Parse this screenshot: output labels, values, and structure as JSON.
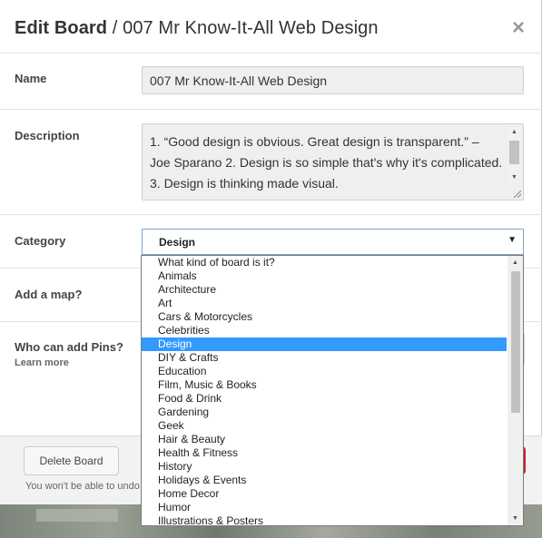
{
  "header": {
    "title_strong": "Edit Board",
    "title_separator": " / ",
    "title_board": "007 Mr Know-It-All Web Design",
    "close_glyph": "×"
  },
  "form": {
    "name_label": "Name",
    "name_value": "007 Mr Know-It-All Web Design",
    "description_label": "Description",
    "description_value": "1. “Good design is obvious. Great design is transparent.” – Joe Sparano 2. Design is so simple that's why it's complicated. 3. Design is thinking made visual.",
    "category_label": "Category",
    "category_value": "Design",
    "map_label": "Add a map?",
    "pins_label": "Who can add Pins?",
    "learn_more": "Learn more"
  },
  "category_options": [
    "What kind of board is it?",
    "Animals",
    "Architecture",
    "Art",
    "Cars & Motorcycles",
    "Celebrities",
    "Design",
    "DIY & Crafts",
    "Education",
    "Film, Music & Books",
    "Food & Drink",
    "Gardening",
    "Geek",
    "Hair & Beauty",
    "Health & Fitness",
    "History",
    "Holidays & Events",
    "Home Decor",
    "Humor",
    "Illustrations & Posters"
  ],
  "selected_index": 6,
  "footer": {
    "delete_label": "Delete Board",
    "note": "You won't be able to undo"
  },
  "colors": {
    "selection": "#3399ff",
    "save_button": "#c8232c",
    "focus_border": "#7da2ce"
  },
  "icons": {
    "close": "close-icon",
    "dropdown_arrow": "triangle-down-icon",
    "scroll_up": "triangle-up-icon",
    "scroll_down": "triangle-down-icon"
  }
}
